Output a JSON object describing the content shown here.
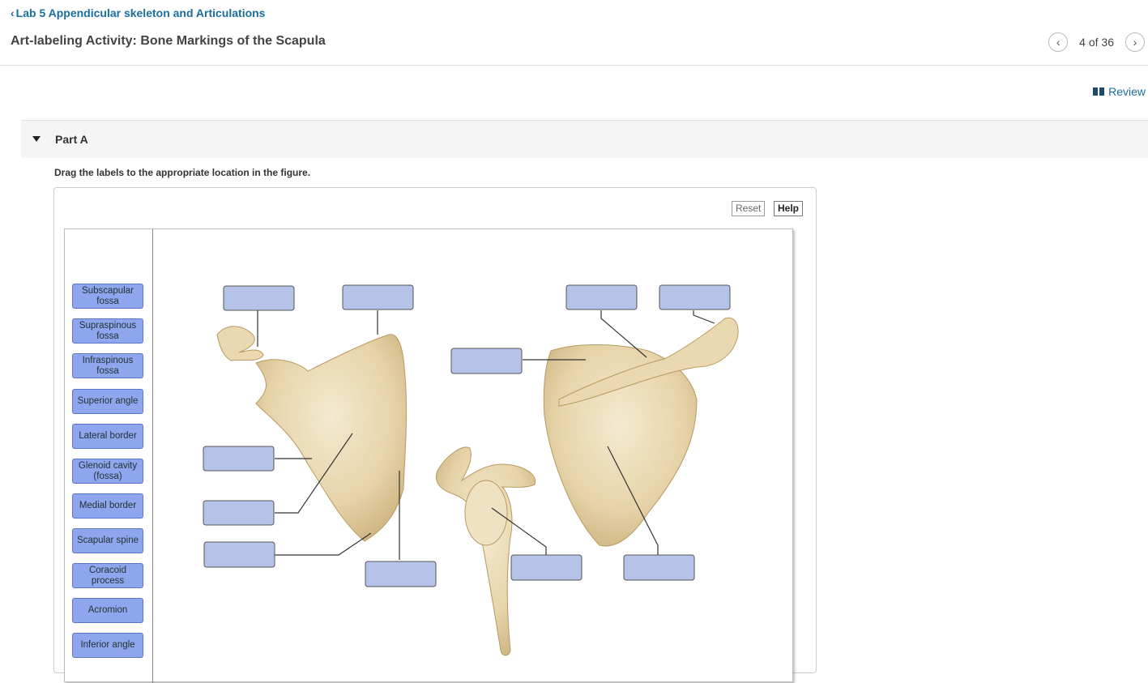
{
  "header": {
    "breadcrumb": "Lab 5 Appendicular skeleton and Articulations",
    "title": "Art-labeling Activity: Bone Markings of the Scapula",
    "pager": "4 of 36",
    "review": "Review"
  },
  "part": {
    "title": "Part A"
  },
  "instruction": "Drag the labels to the appropriate location in the figure.",
  "toolbar": {
    "reset": "Reset",
    "help": "Help"
  },
  "labels": [
    "Subscapular fossa",
    "Supraspinous fossa",
    "Infraspinous fossa",
    "Superior angle",
    "Lateral border",
    "Glenoid cavity (fossa)",
    "Medial border",
    "Scapular spine",
    "Coracoid process",
    "Acromion",
    "Inferior angle"
  ],
  "colors": {
    "link": "#1a6e9e",
    "label_chip": "#8ea6ee",
    "drop_target": "#b5c3e8",
    "bone": "#e6d3a8"
  }
}
